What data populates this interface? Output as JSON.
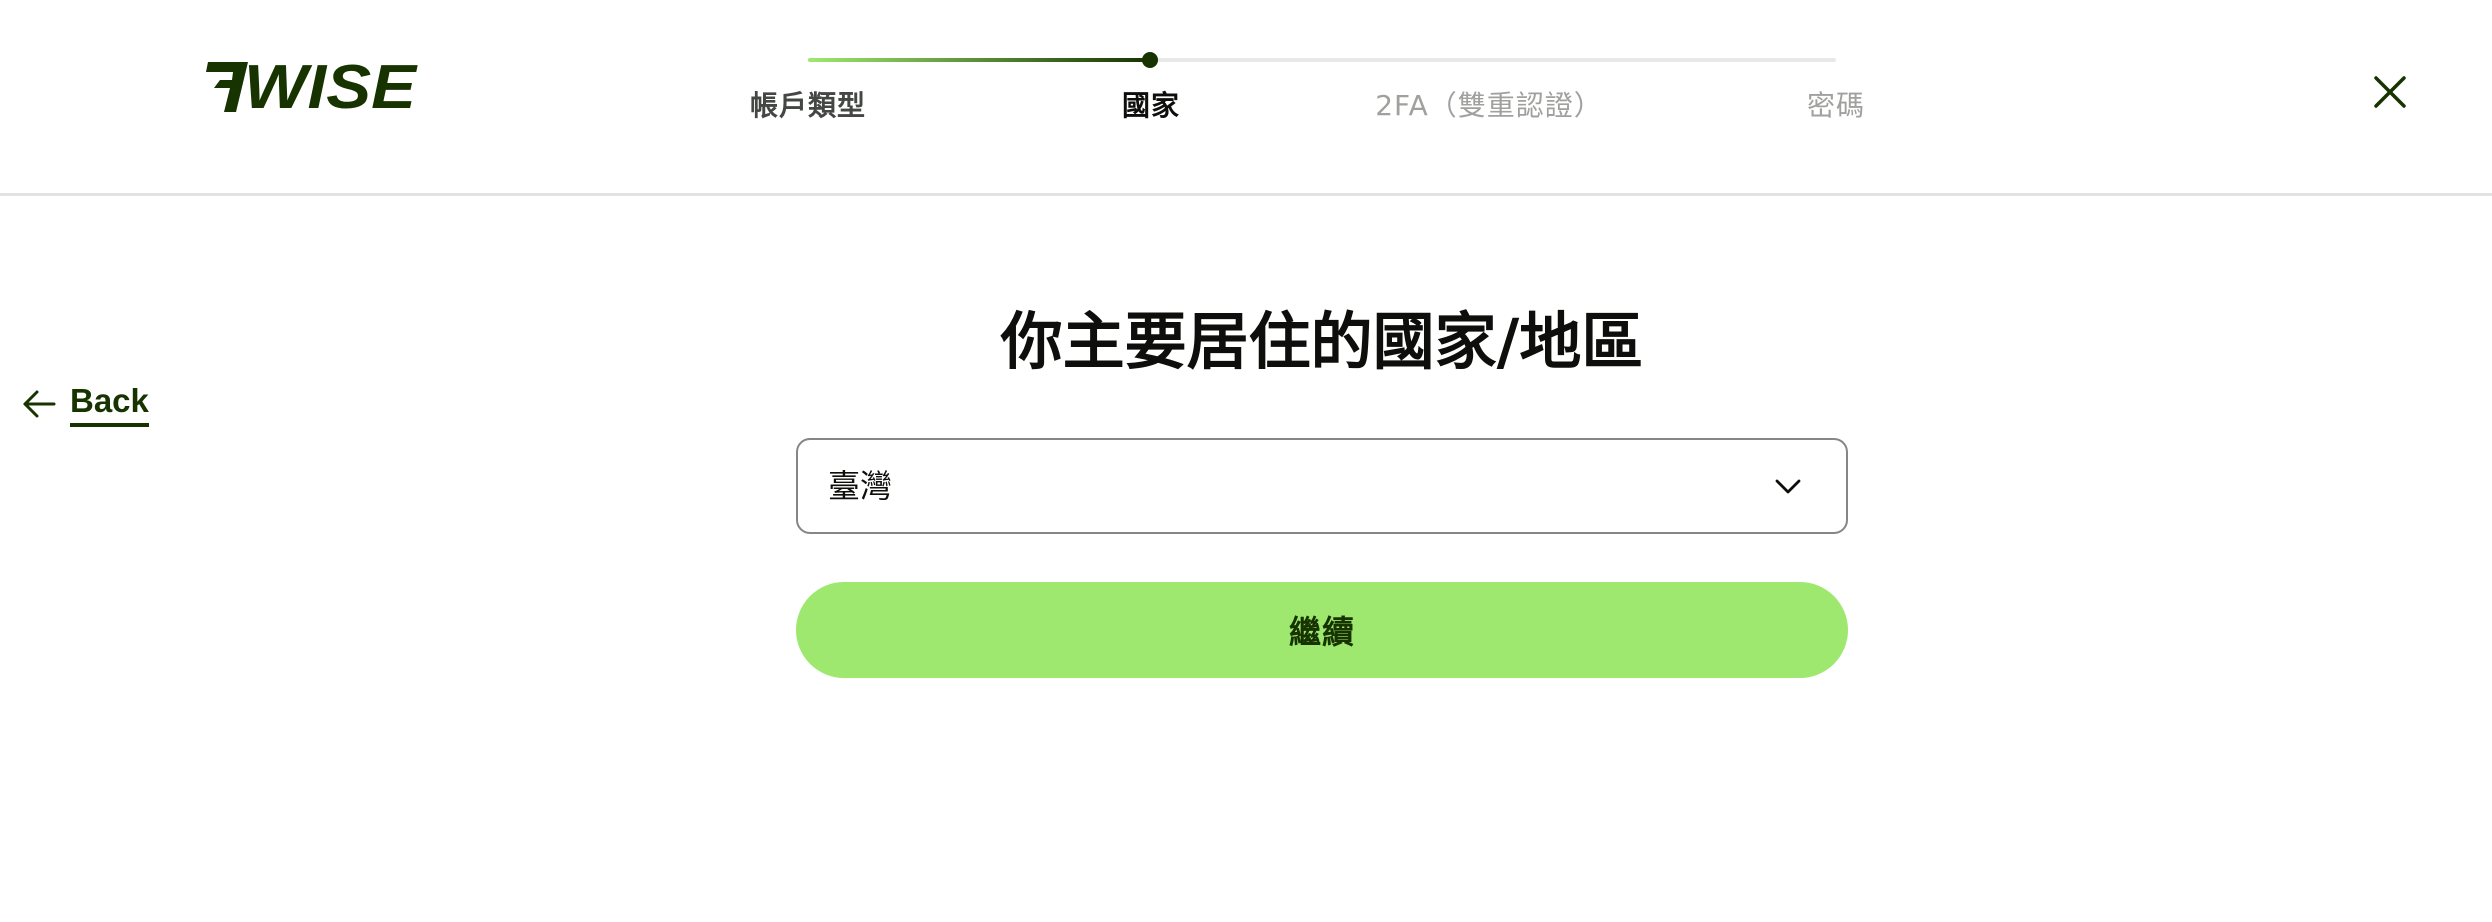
{
  "brand": {
    "name": "WISE",
    "icon": "wise-flag-logo",
    "color_dark": "#163300",
    "color_accent": "#9fe870"
  },
  "stepper": {
    "progress": 0.333,
    "steps": [
      {
        "label": "帳戶類型",
        "state": "done"
      },
      {
        "label": "國家",
        "state": "active"
      },
      {
        "label": "2FA（雙重認證）",
        "state": "pending"
      },
      {
        "label": "密碼",
        "state": "pending"
      }
    ]
  },
  "header": {
    "close_icon": "close-icon"
  },
  "nav": {
    "back_label": "Back",
    "back_icon": "arrow-left-icon"
  },
  "main": {
    "title": "你主要居住的國家/地區",
    "country_select": {
      "value": "臺灣",
      "icon": "chevron-down-icon"
    },
    "continue_label": "繼續"
  }
}
